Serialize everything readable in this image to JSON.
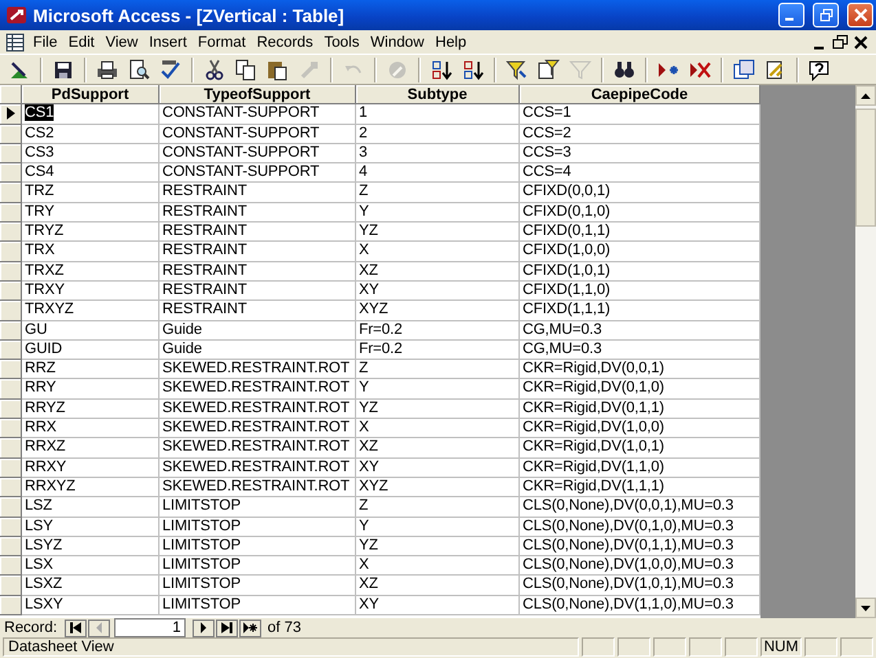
{
  "window": {
    "title": "Microsoft Access - [ZVertical : Table]"
  },
  "menu": [
    "File",
    "Edit",
    "View",
    "Insert",
    "Format",
    "Records",
    "Tools",
    "Window",
    "Help"
  ],
  "toolbar": [
    {
      "kind": "design",
      "disabled": false
    },
    {
      "kind": "sep"
    },
    {
      "kind": "save",
      "disabled": false
    },
    {
      "kind": "sep"
    },
    {
      "kind": "print",
      "disabled": false
    },
    {
      "kind": "preview",
      "disabled": false
    },
    {
      "kind": "spelling",
      "disabled": false
    },
    {
      "kind": "sep"
    },
    {
      "kind": "cut",
      "disabled": false
    },
    {
      "kind": "copy",
      "disabled": false
    },
    {
      "kind": "paste",
      "disabled": false
    },
    {
      "kind": "brush",
      "disabled": true
    },
    {
      "kind": "sep"
    },
    {
      "kind": "undo",
      "disabled": true
    },
    {
      "kind": "sep"
    },
    {
      "kind": "link",
      "disabled": true
    },
    {
      "kind": "sep"
    },
    {
      "kind": "sortasc",
      "disabled": false
    },
    {
      "kind": "sortdesc",
      "disabled": false
    },
    {
      "kind": "sep"
    },
    {
      "kind": "filtersel",
      "disabled": false
    },
    {
      "kind": "filterform",
      "disabled": false
    },
    {
      "kind": "applyfilter",
      "disabled": true
    },
    {
      "kind": "sep"
    },
    {
      "kind": "find",
      "disabled": false
    },
    {
      "kind": "sep"
    },
    {
      "kind": "newrecord",
      "disabled": false
    },
    {
      "kind": "deleterecord",
      "disabled": false
    },
    {
      "kind": "sep"
    },
    {
      "kind": "dbwindow",
      "disabled": false
    },
    {
      "kind": "newobject",
      "disabled": false
    },
    {
      "kind": "sep"
    },
    {
      "kind": "help",
      "disabled": false
    }
  ],
  "table": {
    "columns": [
      "PdSupport",
      "TypeofSupport",
      "Subtype",
      "CaepipeCode"
    ],
    "rows": [
      {
        "selected": true,
        "cells": [
          "CS1",
          "CONSTANT-SUPPORT",
          "1",
          "CCS=1"
        ]
      },
      {
        "selected": false,
        "cells": [
          "CS2",
          "CONSTANT-SUPPORT",
          "2",
          "CCS=2"
        ]
      },
      {
        "selected": false,
        "cells": [
          "CS3",
          "CONSTANT-SUPPORT",
          "3",
          "CCS=3"
        ]
      },
      {
        "selected": false,
        "cells": [
          "CS4",
          "CONSTANT-SUPPORT",
          "4",
          "CCS=4"
        ]
      },
      {
        "selected": false,
        "cells": [
          "TRZ",
          "RESTRAINT",
          "Z",
          "CFIXD(0,0,1)"
        ]
      },
      {
        "selected": false,
        "cells": [
          "TRY",
          "RESTRAINT",
          "Y",
          "CFIXD(0,1,0)"
        ]
      },
      {
        "selected": false,
        "cells": [
          "TRYZ",
          "RESTRAINT",
          "YZ",
          "CFIXD(0,1,1)"
        ]
      },
      {
        "selected": false,
        "cells": [
          "TRX",
          "RESTRAINT",
          "X",
          "CFIXD(1,0,0)"
        ]
      },
      {
        "selected": false,
        "cells": [
          "TRXZ",
          "RESTRAINT",
          "XZ",
          "CFIXD(1,0,1)"
        ]
      },
      {
        "selected": false,
        "cells": [
          "TRXY",
          "RESTRAINT",
          "XY",
          "CFIXD(1,1,0)"
        ]
      },
      {
        "selected": false,
        "cells": [
          "TRXYZ",
          "RESTRAINT",
          "XYZ",
          "CFIXD(1,1,1)"
        ]
      },
      {
        "selected": false,
        "cells": [
          "GU",
          "Guide",
          "Fr=0.2",
          "CG,MU=0.3"
        ]
      },
      {
        "selected": false,
        "cells": [
          "GUID",
          "Guide",
          "Fr=0.2",
          "CG,MU=0.3"
        ]
      },
      {
        "selected": false,
        "cells": [
          "RRZ",
          "SKEWED.RESTRAINT.ROT",
          "Z",
          "CKR=Rigid,DV(0,0,1)"
        ]
      },
      {
        "selected": false,
        "cells": [
          "RRY",
          "SKEWED.RESTRAINT.ROT",
          "Y",
          "CKR=Rigid,DV(0,1,0)"
        ]
      },
      {
        "selected": false,
        "cells": [
          "RRYZ",
          "SKEWED.RESTRAINT.ROT",
          "YZ",
          "CKR=Rigid,DV(0,1,1)"
        ]
      },
      {
        "selected": false,
        "cells": [
          "RRX",
          "SKEWED.RESTRAINT.ROT",
          "X",
          "CKR=Rigid,DV(1,0,0)"
        ]
      },
      {
        "selected": false,
        "cells": [
          "RRXZ",
          "SKEWED.RESTRAINT.ROT",
          "XZ",
          "CKR=Rigid,DV(1,0,1)"
        ]
      },
      {
        "selected": false,
        "cells": [
          "RRXY",
          "SKEWED.RESTRAINT.ROT",
          "XY",
          "CKR=Rigid,DV(1,1,0)"
        ]
      },
      {
        "selected": false,
        "cells": [
          "RRXYZ",
          "SKEWED.RESTRAINT.ROT",
          "XYZ",
          "CKR=Rigid,DV(1,1,1)"
        ]
      },
      {
        "selected": false,
        "cells": [
          "LSZ",
          "LIMITSTOP",
          "Z",
          "CLS(0,None),DV(0,0,1),MU=0.3"
        ]
      },
      {
        "selected": false,
        "cells": [
          "LSY",
          "LIMITSTOP",
          "Y",
          "CLS(0,None),DV(0,1,0),MU=0.3"
        ]
      },
      {
        "selected": false,
        "cells": [
          "LSYZ",
          "LIMITSTOP",
          "YZ",
          "CLS(0,None),DV(0,1,1),MU=0.3"
        ]
      },
      {
        "selected": false,
        "cells": [
          "LSX",
          "LIMITSTOP",
          "X",
          "CLS(0,None),DV(1,0,0),MU=0.3"
        ]
      },
      {
        "selected": false,
        "cells": [
          "LSXZ",
          "LIMITSTOP",
          "XZ",
          "CLS(0,None),DV(1,0,1),MU=0.3"
        ]
      },
      {
        "selected": false,
        "cells": [
          "LSXY",
          "LIMITSTOP",
          "XY",
          "CLS(0,None),DV(1,1,0),MU=0.3"
        ]
      }
    ]
  },
  "navigation": {
    "label": "Record:",
    "current": "1",
    "total": "of 73"
  },
  "status_bar": {
    "text": "Datasheet View",
    "indicators": [
      "NUM"
    ]
  }
}
